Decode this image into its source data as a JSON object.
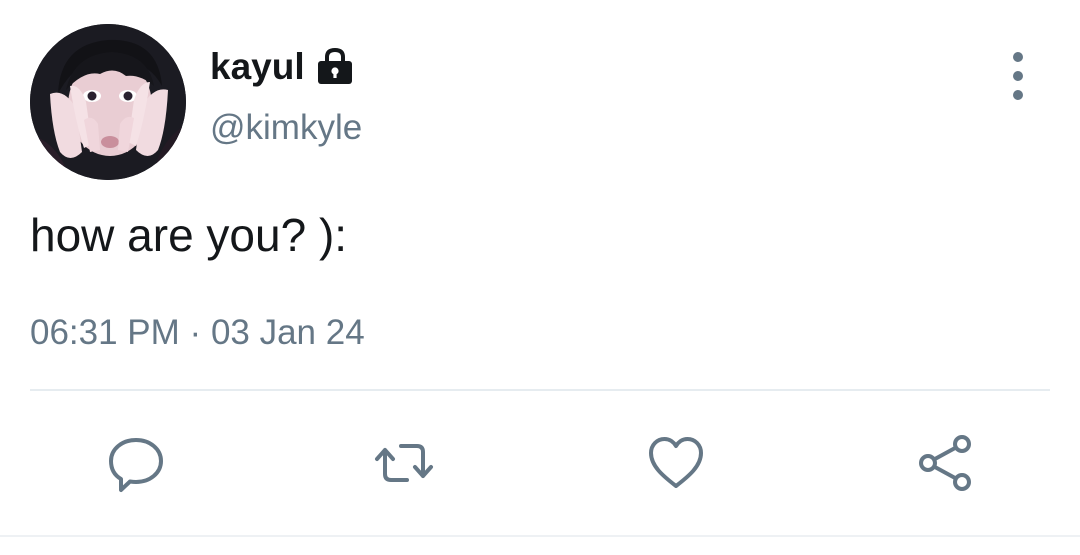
{
  "tweet": {
    "display_name": "kayul",
    "handle": "@kimkyle",
    "text": "how are you? ):",
    "time": "06:31 PM",
    "separator": "·",
    "date": "03 Jan 24",
    "protected": true
  },
  "icons": {
    "lock": "lock-icon",
    "more": "more-vertical-icon",
    "reply": "reply-icon",
    "retweet": "retweet-icon",
    "like": "heart-icon",
    "share": "share-icon"
  },
  "colors": {
    "primary_text": "#14171a",
    "secondary_text": "#657786",
    "divider": "#e6ecf0"
  }
}
